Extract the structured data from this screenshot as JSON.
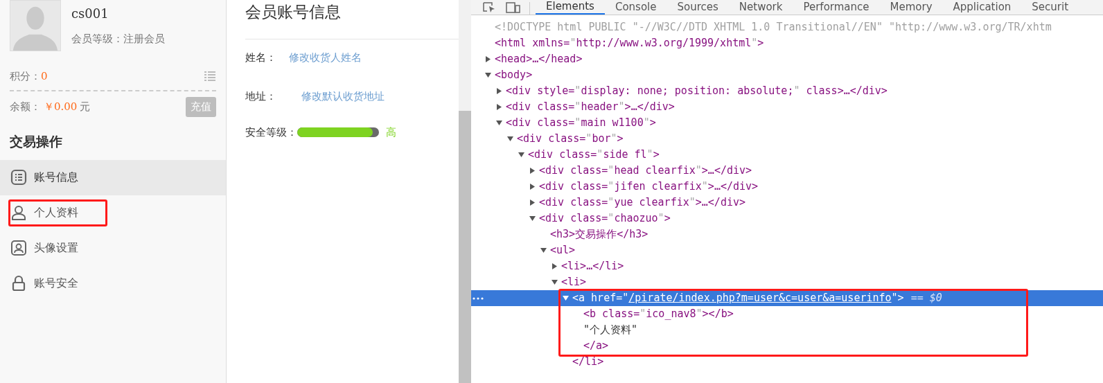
{
  "sidebar": {
    "username": "cs001",
    "member_level": "会员等级：注册会员",
    "points_label": "积分：",
    "points_value": "0",
    "balance_label": "余额：",
    "balance_value": "￥0.00",
    "balance_unit": "元",
    "recharge_button": "充值",
    "section_title": "交易操作",
    "menu": [
      {
        "label": "账号信息",
        "kind": "list",
        "selected": true,
        "highlighted": false
      },
      {
        "label": "个人资料",
        "kind": "person",
        "selected": false,
        "highlighted": true
      },
      {
        "label": "头像设置",
        "kind": "portrait",
        "selected": false,
        "highlighted": false
      },
      {
        "label": "账号安全",
        "kind": "lock",
        "selected": false,
        "highlighted": false
      }
    ]
  },
  "content": {
    "title": "会员账号信息",
    "fields": [
      {
        "label": "姓名：",
        "link": "修改收货人姓名"
      },
      {
        "label": "地址：",
        "link": "修改默认收货地址"
      }
    ],
    "security": {
      "label": "安全等级：",
      "level": 0.92,
      "reading": "高"
    }
  },
  "devtools": {
    "tabs": [
      {
        "label": "Elements",
        "selected": true
      },
      {
        "label": "Console",
        "selected": false
      },
      {
        "label": "Sources",
        "selected": false
      },
      {
        "label": "Network",
        "selected": false
      },
      {
        "label": "Performance",
        "selected": false
      },
      {
        "label": "Memory",
        "selected": false
      },
      {
        "label": "Application",
        "selected": false
      },
      {
        "label": "Securit",
        "selected": false
      }
    ],
    "tree": [
      {
        "kind": "doctype",
        "text": "<!DOCTYPE html PUBLIC \"-//W3C//DTD XHTML 1.0 Transitional//EN\" \"http://www.w3.org/TR/xhtm"
      },
      {
        "kind": "tag",
        "text": "<html xmlns=\"http://www.w3.org/1999/xhtml\">"
      },
      {
        "kind": "tag",
        "text": "<head>…</head>",
        "expanded": false
      },
      {
        "kind": "tag",
        "text": "<body>",
        "expanded": true,
        "children": [
          {
            "kind": "tag",
            "text": "<div style=\"display: none; position: absolute;\" class>…</div>",
            "expanded": false
          },
          {
            "kind": "tag",
            "text": "<div class=\"header\">…</div>",
            "expanded": false
          },
          {
            "kind": "tag",
            "text": "<div class=\"main w1100\">",
            "expanded": true,
            "children": [
              {
                "kind": "tag",
                "text": "<div class=\"bor\">",
                "expanded": true,
                "children": [
                  {
                    "kind": "tag",
                    "text": "<div class=\"side fl\">",
                    "expanded": true,
                    "children": [
                      {
                        "kind": "tag",
                        "text": "<div class=\"head clearfix\">…</div>",
                        "expanded": false
                      },
                      {
                        "kind": "tag",
                        "text": "<div class=\"jifen clearfix\">…</div>",
                        "expanded": false
                      },
                      {
                        "kind": "tag",
                        "text": "<div class=\"yue clearfix\">…</div>",
                        "expanded": false
                      },
                      {
                        "kind": "tag",
                        "text": "<div class=\"chaozuo\">",
                        "expanded": true,
                        "children": [
                          {
                            "kind": "tag",
                            "text": "<h3>交易操作</h3>"
                          },
                          {
                            "kind": "tag",
                            "text": "<ul>",
                            "expanded": true,
                            "children": [
                              {
                                "kind": "tag",
                                "text": "<li>…</li>",
                                "expanded": false
                              },
                              {
                                "kind": "tag",
                                "text": "<li>",
                                "expanded": true,
                                "children": [
                                  {
                                    "kind": "tag",
                                    "text": "<a href=\"/pirate/index.php?m=user&c=user&a=userinfo\">",
                                    "suffix": "== $0",
                                    "link_value": true,
                                    "selected": true,
                                    "highlighted": true,
                                    "expanded": true,
                                    "children": [
                                      {
                                        "kind": "tag",
                                        "text": "<b class=\"ico_nav8\"></b>"
                                      },
                                      {
                                        "kind": "string",
                                        "text": "\"个人资料\""
                                      },
                                      {
                                        "kind": "tag",
                                        "text": "</a>"
                                      }
                                    ]
                                  },
                                  {
                                    "kind": "tag",
                                    "text": "</li>"
                                  }
                                ]
                              }
                            ]
                          }
                        ]
                      }
                    ]
                  }
                ]
              }
            ]
          }
        ]
      }
    ]
  }
}
